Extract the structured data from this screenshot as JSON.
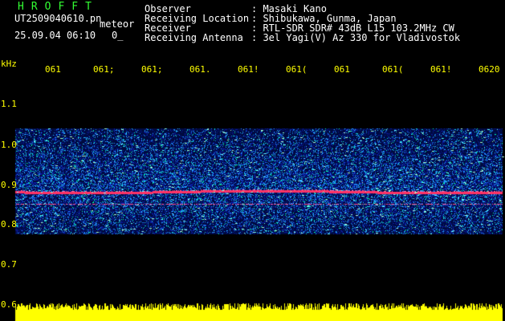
{
  "app": {
    "title": "HROFFT",
    "filename": "UT2509040610.pn",
    "mode_label": "meteor",
    "datetime": "25.09.04 06:10",
    "counter": "0_"
  },
  "station": {
    "labels": [
      "Observer",
      "Receiving Location",
      "Receiver",
      "Receiving Antenna"
    ],
    "values": [
      ": Masaki Kano",
      ": Shibukawa, Gunma, Japan",
      ": RTL-SDR SDR# 43dB L15 103.2MHz CW",
      ": 3el Yagi(V) Az 330 for Vladivostok"
    ]
  },
  "axis": {
    "unit": "kHz",
    "freq_ticks": [
      "1.1",
      "1.0",
      "0.9",
      "0.8",
      "0.7",
      "0.6"
    ],
    "time_ticks": [
      "061",
      "061;",
      "061;",
      "061.",
      "061!",
      "061(",
      "061",
      "061(",
      "061!",
      "0620"
    ]
  },
  "colors": {
    "background": "#000000",
    "text_header": "#ffffff",
    "text_title": "#33ff33",
    "ticks": "#ffff00",
    "carrier": "#ff3366",
    "noise_low": "#0a1aa0",
    "noise_mid": "#1e8cff",
    "noise_high": "#00ffaa",
    "audio": "#ffff00"
  }
}
